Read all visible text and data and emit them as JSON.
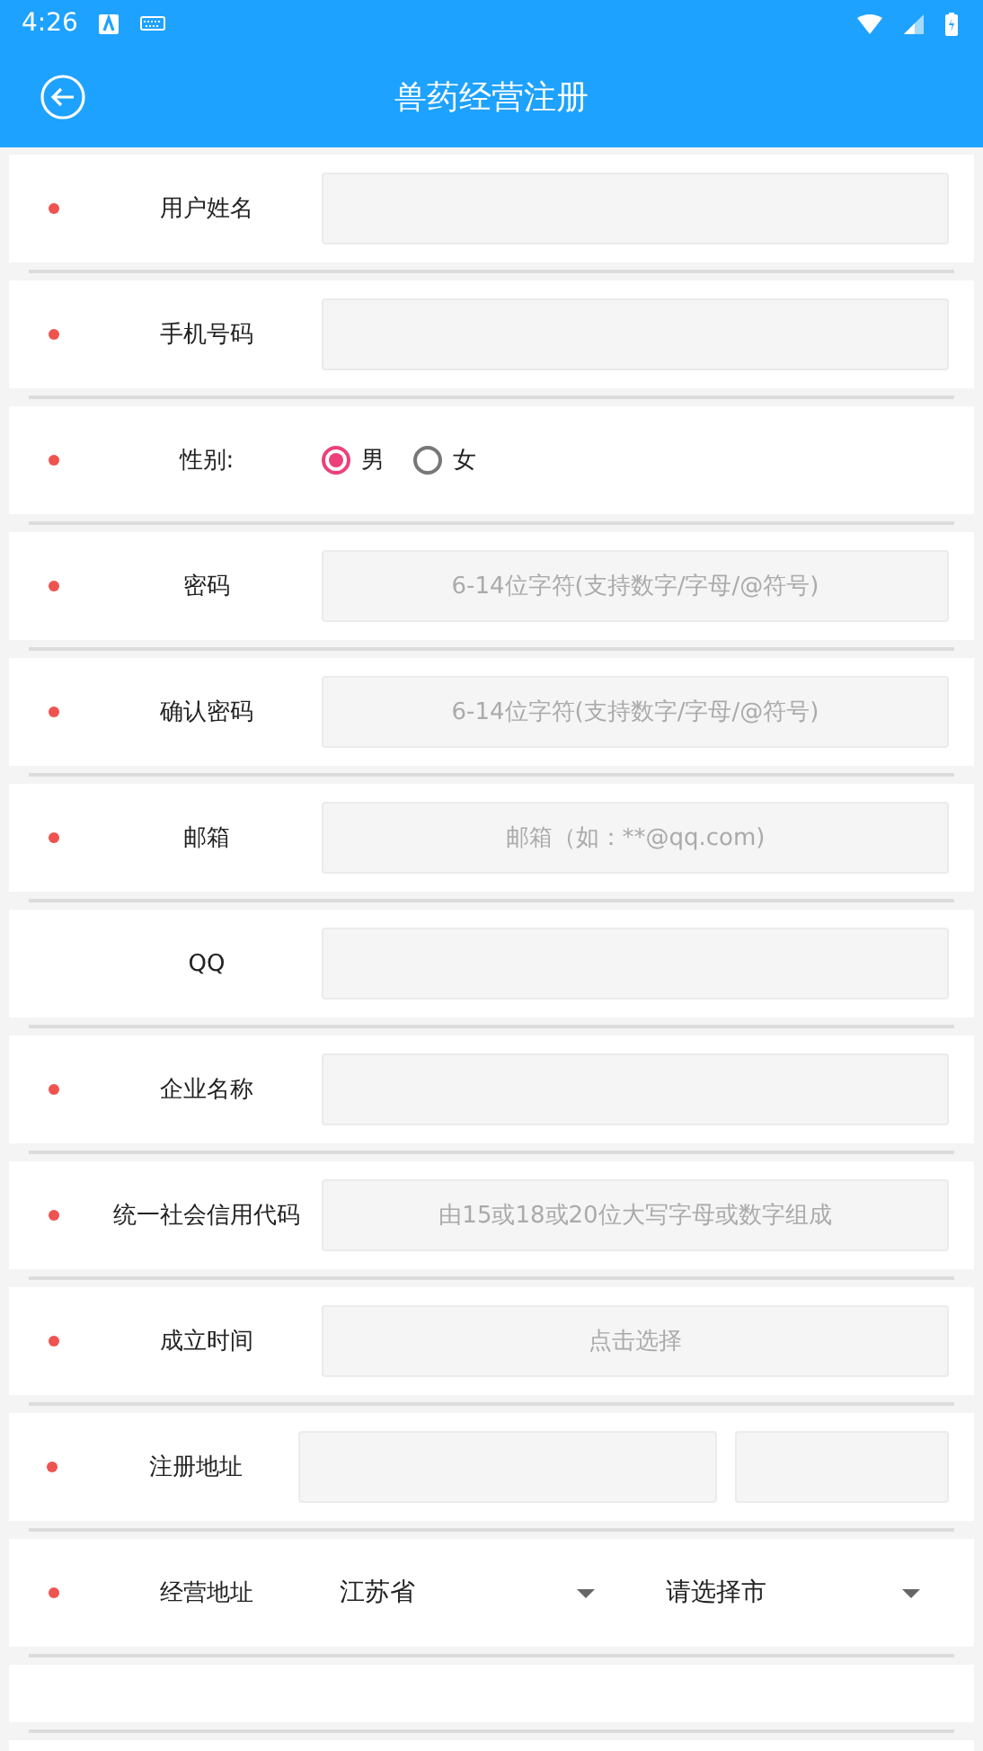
{
  "status_bar": {
    "time": "4:26"
  },
  "app_bar": {
    "title": "兽药经营注册"
  },
  "fields": [
    {
      "kind": "input",
      "label": "用户姓名",
      "required": true
    },
    {
      "kind": "input",
      "label": "手机号码",
      "required": true
    },
    {
      "kind": "radio",
      "label": "性别:",
      "required": true,
      "options": [
        {
          "label": "男",
          "selected": true
        },
        {
          "label": "女",
          "selected": false
        }
      ]
    },
    {
      "kind": "input",
      "label": "密码",
      "required": true,
      "placeholder": "6-14位字符(支持数字/字母/@符号)"
    },
    {
      "kind": "input",
      "label": "确认密码",
      "required": true,
      "placeholder": "6-14位字符(支持数字/字母/@符号)"
    },
    {
      "kind": "input",
      "label": "邮箱",
      "required": true,
      "placeholder": "邮箱（如：**@qq.com)"
    },
    {
      "kind": "input",
      "label": "QQ",
      "required": false
    },
    {
      "kind": "input",
      "label": "企业名称",
      "required": true
    },
    {
      "kind": "input",
      "label": "统一社会信用代码",
      "required": true,
      "placeholder": "由15或18或20位大写字母或数字组成"
    },
    {
      "kind": "input",
      "label": "成立时间",
      "required": true,
      "placeholder": "点击选择"
    },
    {
      "kind": "double",
      "label": "注册地址",
      "required": true
    },
    {
      "kind": "select",
      "label": "经营地址",
      "required": true,
      "selects": [
        {
          "value": "江苏省"
        },
        {
          "value": "请选择市"
        }
      ]
    },
    {
      "kind": "blank"
    }
  ]
}
